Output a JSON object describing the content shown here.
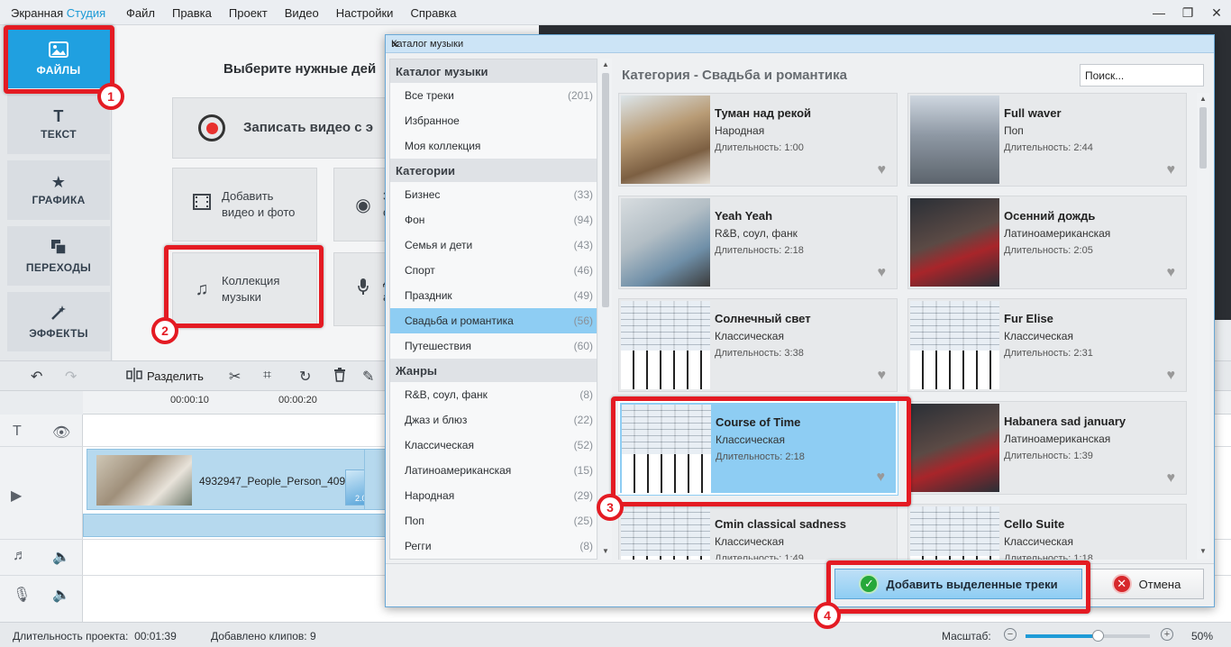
{
  "app": {
    "title_main": "Экранная ",
    "title_accent": "Студия"
  },
  "menu": [
    "Файл",
    "Правка",
    "Проект",
    "Видео",
    "Настройки",
    "Справка"
  ],
  "window_controls": [
    "—",
    "❐",
    "✕"
  ],
  "sidebar": {
    "items": [
      {
        "label": "ФАЙЛЫ",
        "icon": "image-icon"
      },
      {
        "label": "ТЕКСТ",
        "icon": "text-icon"
      },
      {
        "label": "ГРАФИКА",
        "icon": "star-icon"
      },
      {
        "label": "ПЕРЕХОДЫ",
        "icon": "transitions-icon"
      },
      {
        "label": "ЭФФЕКТЫ",
        "icon": "magic-wand-icon"
      }
    ]
  },
  "files_panel": {
    "title": "Выберите нужные дей",
    "record": "Записать видео с э",
    "add_media": "Добавить\nвидео и фото",
    "webcam": "З\nс",
    "music_collection": "Коллекция\nмузыки",
    "voice": "Д\nа"
  },
  "timeline": {
    "split_label": "Разделить",
    "ticks": [
      "00:00:10",
      "00:00:20"
    ],
    "clip_name": "4932947_People_Person_409",
    "transition_duration": "2.0"
  },
  "status": {
    "duration_label": "Длительность проекта:",
    "duration_value": "00:01:39",
    "clips_label": "Добавлено клипов:",
    "clips_value": "9",
    "scale_label": "Масштаб:",
    "zoom_value": "50%",
    "zoom_fraction": 0.58
  },
  "dialog": {
    "title": "Каталог музыки",
    "close": "✕",
    "category_heading": "Категория - Свадьба и романтика",
    "search_placeholder": "Поиск...",
    "add_button": "Добавить выделенные треки",
    "cancel_button": "Отмена",
    "sections": [
      {
        "header": "Каталог музыки",
        "items": [
          {
            "label": "Все треки",
            "count": "(201)"
          },
          {
            "label": "Избранное",
            "count": ""
          },
          {
            "label": "Моя коллекция",
            "count": ""
          }
        ]
      },
      {
        "header": "Категории",
        "items": [
          {
            "label": "Бизнес",
            "count": "(33)"
          },
          {
            "label": "Фон",
            "count": "(94)"
          },
          {
            "label": "Семья и дети",
            "count": "(43)"
          },
          {
            "label": "Спорт",
            "count": "(46)"
          },
          {
            "label": "Праздник",
            "count": "(49)"
          },
          {
            "label": "Свадьба и романтика",
            "count": "(56)",
            "selected": true
          },
          {
            "label": "Путешествия",
            "count": "(60)"
          }
        ]
      },
      {
        "header": "Жанры",
        "items": [
          {
            "label": "R&B, соул, фанк",
            "count": "(8)"
          },
          {
            "label": "Джаз и блюз",
            "count": "(22)"
          },
          {
            "label": "Классическая",
            "count": "(52)"
          },
          {
            "label": "Латиноамериканская",
            "count": "(15)"
          },
          {
            "label": "Народная",
            "count": "(29)"
          },
          {
            "label": "Поп",
            "count": "(25)"
          },
          {
            "label": "Регги",
            "count": "(8)"
          }
        ]
      }
    ],
    "tracks": [
      {
        "title": "Туман над рекой",
        "genre": "Народная",
        "duration": "Длительность: 1:00",
        "thumb": "guitar"
      },
      {
        "title": "Full waver",
        "genre": "Поп",
        "duration": "Длительность: 2:44",
        "thumb": "street"
      },
      {
        "title": "Yeah Yeah",
        "genre": "R&B, соул, фанк",
        "duration": "Длительность: 2:18",
        "thumb": "girl"
      },
      {
        "title": "Осенний дождь",
        "genre": "Латиноамериканская",
        "duration": "Длительность: 2:05",
        "thumb": "dance"
      },
      {
        "title": "Солнечный свет",
        "genre": "Классическая",
        "duration": "Длительность: 3:38",
        "thumb": "classic"
      },
      {
        "title": "Fur Elise",
        "genre": "Классическая",
        "duration": "Длительность: 2:31",
        "thumb": "classic"
      },
      {
        "title": "Course of Time",
        "genre": "Классическая",
        "duration": "Длительность: 2:18",
        "thumb": "classic",
        "selected": true
      },
      {
        "title": "Habanera sad january",
        "genre": "Латиноамериканская",
        "duration": "Длительность: 1:39",
        "thumb": "dance"
      },
      {
        "title": "Cmin classical sadness",
        "genre": "Классическая",
        "duration": "Длительность: 1:49",
        "thumb": "classic"
      },
      {
        "title": "Cello Suite",
        "genre": "Классическая",
        "duration": "Длительность: 1:18",
        "thumb": "classic"
      }
    ]
  },
  "annotations": [
    "1",
    "2",
    "3",
    "4"
  ],
  "colors": {
    "accent": "#20a0e0",
    "selection": "#8ecdf3",
    "highlight": "#e41b23"
  }
}
